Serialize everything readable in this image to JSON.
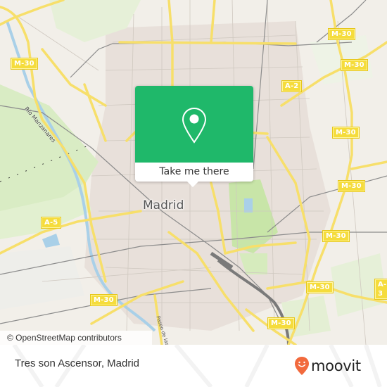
{
  "map": {
    "city_label": "Madrid",
    "river_label": "Río Manzanares",
    "street_label": "Paseo de las Delicias",
    "road_shields": [
      {
        "id": "m30-nw",
        "label": "M-30"
      },
      {
        "id": "m30-ne-top",
        "label": "M-30"
      },
      {
        "id": "m30-ne-1",
        "label": "M-30"
      },
      {
        "id": "m30-ne-2",
        "label": "M-30"
      },
      {
        "id": "m30-e-1",
        "label": "M-30"
      },
      {
        "id": "m30-e-2",
        "label": "M-30"
      },
      {
        "id": "m30-e-3",
        "label": "M-30"
      },
      {
        "id": "m30-se",
        "label": "M-30"
      },
      {
        "id": "m30-sw",
        "label": "M-30"
      },
      {
        "id": "a2",
        "label": "A-2"
      },
      {
        "id": "a5",
        "label": "A-5"
      },
      {
        "id": "a3",
        "label": "A-3"
      }
    ],
    "attribution": "© OpenStreetMap contributors"
  },
  "popup": {
    "icon": "map-pin-icon",
    "action_label": "Take me there",
    "color": "#1fb86a"
  },
  "footer": {
    "place_title": "Tres son Ascensor, Madrid",
    "brand": {
      "name": "moovit",
      "icon": "moovit-logo-icon",
      "color": "#f26a3d"
    }
  }
}
